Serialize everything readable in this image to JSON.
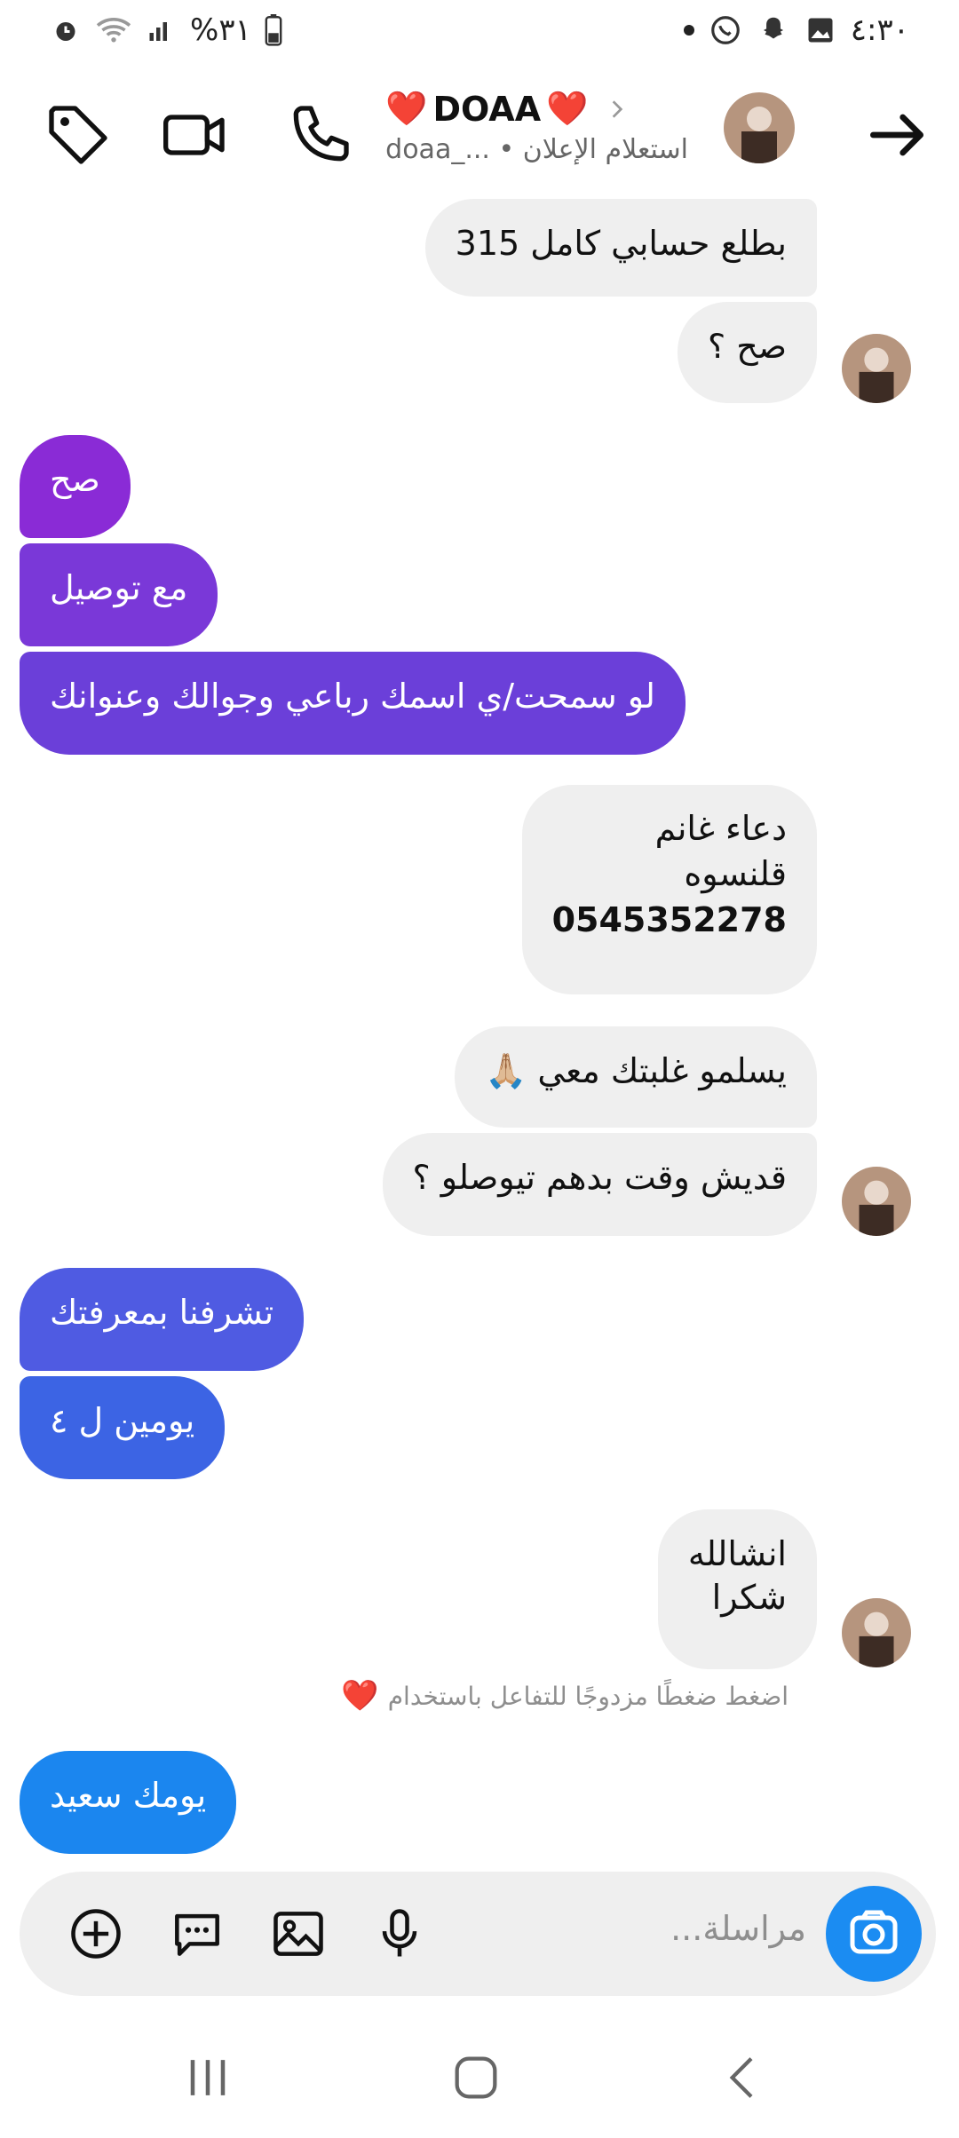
{
  "status_bar": {
    "time": "٤:٣٠",
    "battery": "%٣١"
  },
  "header": {
    "title": "DOAA",
    "subtitle": "استعلام الإعلان • ..._doaa"
  },
  "messages": [
    {
      "from": "them",
      "text": "بطلع حسابي كامل 315"
    },
    {
      "from": "them",
      "text": "صح ؟"
    },
    {
      "from": "me",
      "text": "صح"
    },
    {
      "from": "me",
      "text": "مع توصيل"
    },
    {
      "from": "me",
      "text": "لو سمحت/ي اسمك رباعي وجوالك وعنوانك"
    },
    {
      "from": "them",
      "lines": [
        "دعاء غانم",
        "قلنسوه",
        "0545352278"
      ]
    },
    {
      "from": "them",
      "text": "يسلمو غلبتك معي 🙏🏼"
    },
    {
      "from": "them",
      "text": "قديش وقت بدهم تيوصلو ؟"
    },
    {
      "from": "me",
      "text": "تشرفنا بمعرفتك"
    },
    {
      "from": "me",
      "text": "يومين ل ٤"
    },
    {
      "from": "them",
      "lines": [
        "انشالله",
        "شكرا"
      ]
    },
    {
      "from": "me",
      "text": "يومك سعيد"
    }
  ],
  "reaction_hint": "اضغط ضغطًا مزدوجًا للتفاعل باستخدام",
  "composer": {
    "placeholder": "مراسلة..."
  },
  "colors": {
    "bubble_purple_1": "#8a2bd6",
    "bubble_purple_2": "#7a38d8",
    "bubble_purple_3": "#6b3fd9",
    "bubble_blue_1": "#4f5be2",
    "bubble_blue_2": "#3c64e4",
    "bubble_blue_3": "#1b86ef",
    "incoming_bubble": "#efefef",
    "accent": "#1b8cf2"
  }
}
